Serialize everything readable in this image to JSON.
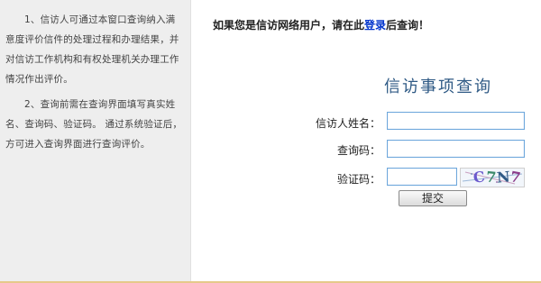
{
  "notes": {
    "note1": "1、信访人可通过本窗口查询纳入满意度评价信件的处理过程和办理结果，并对信访工作机构和有权处理机关办理工作情况作出评价。",
    "note2": "2、查询前需在查询界面填写真实姓名、查询码、验证码。 通过系统验证后，方可进入查询界面进行查询评价。"
  },
  "prompt": {
    "prefix": "如果您是信访网络用户，请在此",
    "login_link": "登录",
    "suffix": "后查询！"
  },
  "form": {
    "title": "信访事项查询",
    "name_label": "信访人姓名：",
    "code_label": "查询码：",
    "verify_label": "验证码：",
    "name_value": "",
    "code_value": "",
    "verify_value": "",
    "captcha_chars": [
      "C",
      "7",
      "N",
      "7"
    ],
    "submit_label": "提交"
  },
  "colors": {
    "left_panel_bg": "#eeeeee",
    "title_color": "#2f5a85",
    "link_color": "#0033cc",
    "input_border": "#6fa8dc",
    "bottom_border": "#e6c98a"
  }
}
